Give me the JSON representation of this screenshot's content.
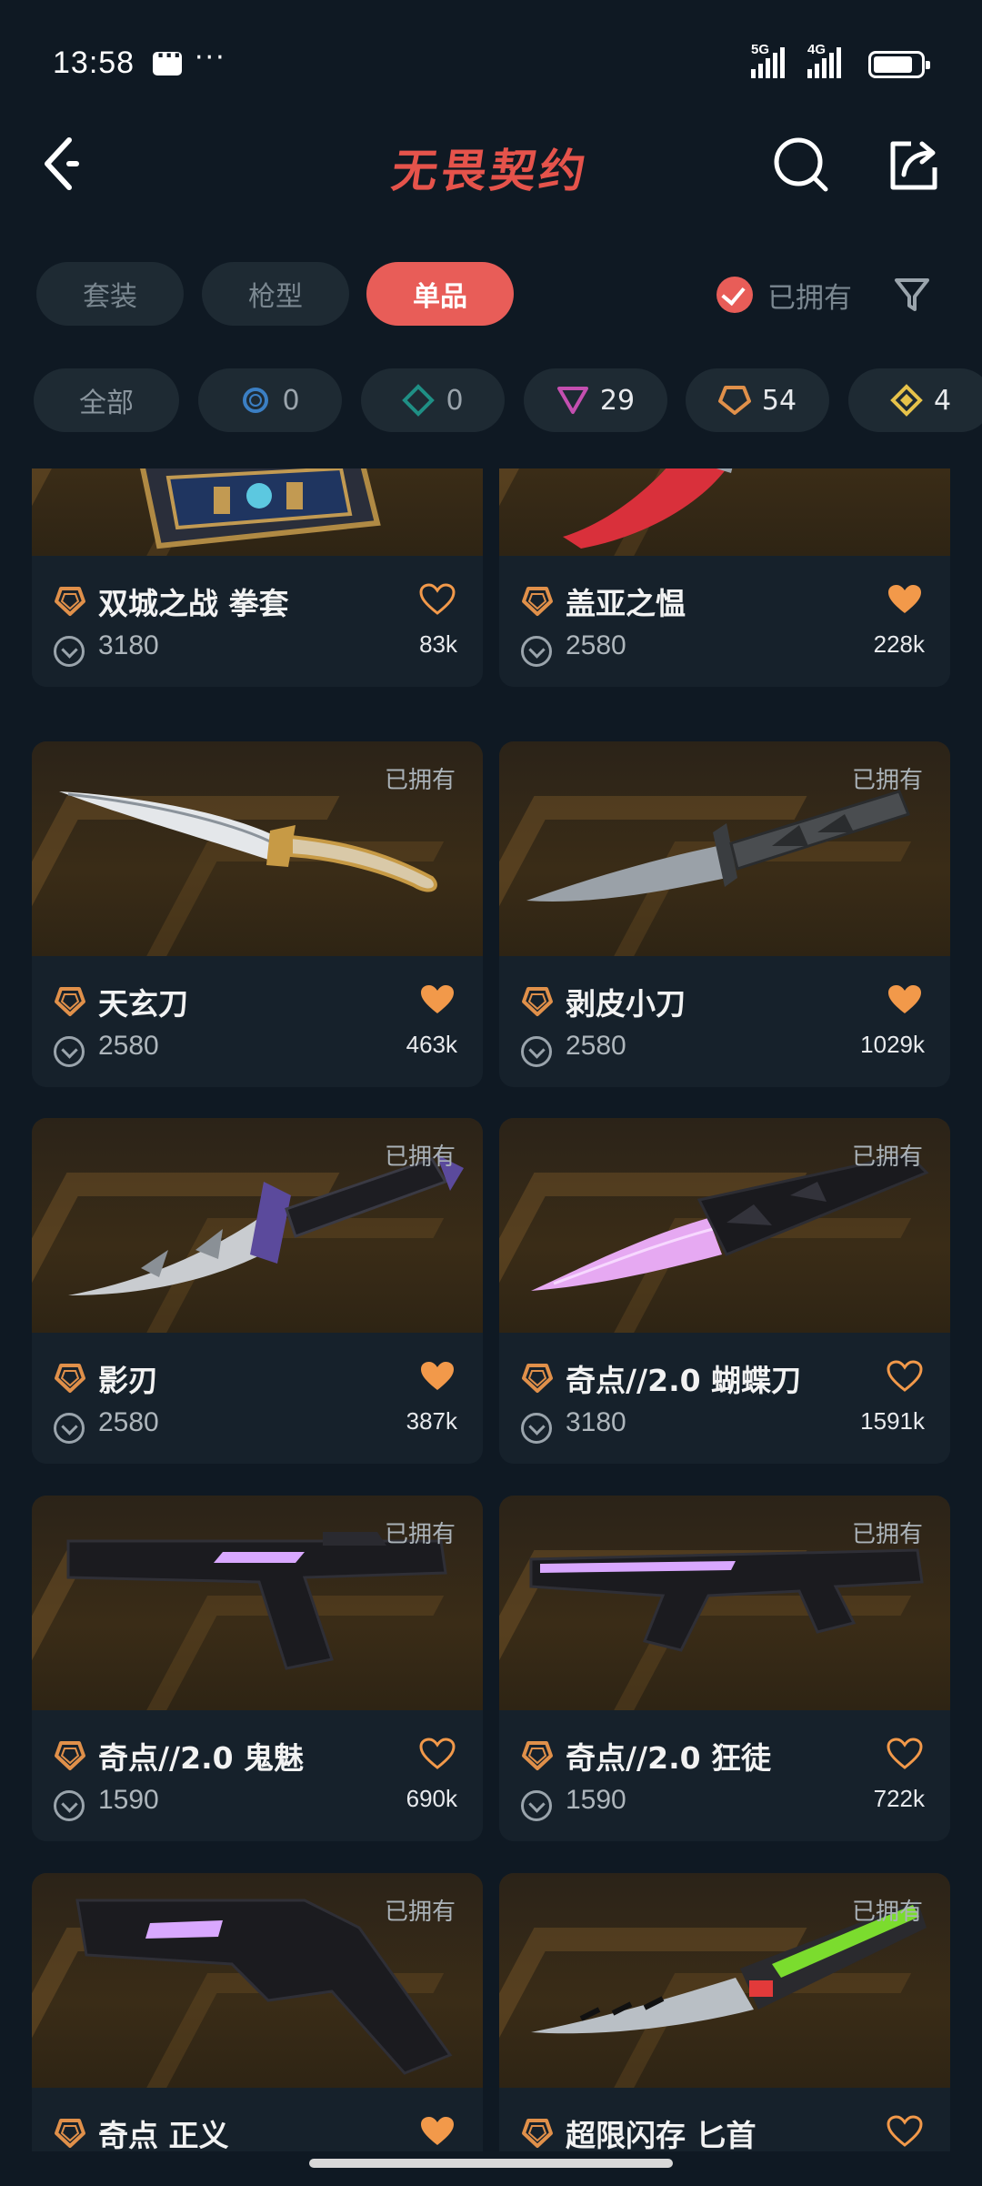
{
  "status_bar": {
    "time": "13:58",
    "net1": "5G",
    "net2": "4G"
  },
  "header": {
    "title": "无畏契约"
  },
  "tabs": [
    {
      "label": "套装",
      "active": false
    },
    {
      "label": "枪型",
      "active": false
    },
    {
      "label": "单品",
      "active": true
    }
  ],
  "owned_filter": {
    "label": "已拥有",
    "checked": true
  },
  "chips": [
    {
      "label": "全部",
      "icon": ""
    },
    {
      "label": "0",
      "icon": "select-tier-icon",
      "color": "#3b7fc4"
    },
    {
      "label": "0",
      "icon": "deluxe-tier-icon",
      "color": "#1f8f85"
    },
    {
      "label": "29",
      "icon": "premium-tier-icon",
      "color": "#c44fb0"
    },
    {
      "label": "54",
      "icon": "exclusive-tier-icon",
      "color": "#e0904a"
    },
    {
      "label": "4",
      "icon": "ultra-tier-icon",
      "color": "#e6c24a"
    }
  ],
  "items": [
    {
      "name": "双城之战 拳套",
      "price": "3180",
      "likes": "83k",
      "liked": false,
      "owned": "",
      "tier_color": "#e0904a"
    },
    {
      "name": "盖亚之愠",
      "price": "2580",
      "likes": "228k",
      "liked": true,
      "owned": "",
      "tier_color": "#e0904a"
    },
    {
      "name": "天玄刀",
      "price": "2580",
      "likes": "463k",
      "liked": true,
      "owned": "已拥有",
      "tier_color": "#e0904a"
    },
    {
      "name": "剥皮小刀",
      "price": "2580",
      "likes": "1029k",
      "liked": true,
      "owned": "已拥有",
      "tier_color": "#e0904a"
    },
    {
      "name": "影刃",
      "price": "2580",
      "likes": "387k",
      "liked": true,
      "owned": "已拥有",
      "tier_color": "#e0904a"
    },
    {
      "name": "奇点//2.0 蝴蝶刀",
      "price": "3180",
      "likes": "1591k",
      "liked": false,
      "owned": "已拥有",
      "tier_color": "#e0904a"
    },
    {
      "name": "奇点//2.0 鬼魅",
      "price": "1590",
      "likes": "690k",
      "liked": false,
      "owned": "已拥有",
      "tier_color": "#e0904a"
    },
    {
      "name": "奇点//2.0 狂徒",
      "price": "1590",
      "likes": "722k",
      "liked": false,
      "owned": "已拥有",
      "tier_color": "#e0904a"
    },
    {
      "name": "奇点 正义",
      "price": "",
      "likes": "",
      "liked": true,
      "owned": "已拥有",
      "tier_color": "#e0904a"
    },
    {
      "name": "超限闪存 匕首",
      "price": "",
      "likes": "",
      "liked": false,
      "owned": "已拥有",
      "tier_color": "#e0904a"
    }
  ]
}
